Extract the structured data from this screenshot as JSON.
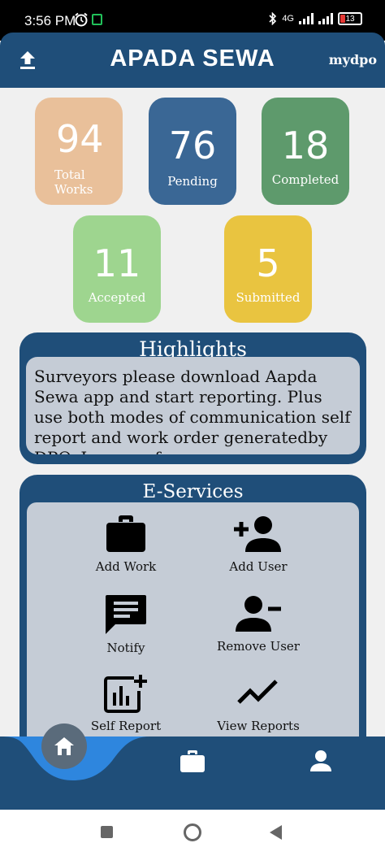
{
  "status_bar": {
    "time": "3:56 PM",
    "network": "4G",
    "battery": "13",
    "icons": [
      "alarm-icon",
      "app-notification-icon",
      "bluetooth-icon",
      "signal-icon",
      "battery-icon"
    ]
  },
  "header": {
    "title": "APADA SEWA",
    "user": "mydpo",
    "left_icon": "upload-icon"
  },
  "stats": {
    "total": {
      "value": "94",
      "label_line1": "Total",
      "label_line2": "Works",
      "color": "#e9c09a"
    },
    "pending": {
      "value": "76",
      "label": "Pending",
      "color": "#3a6795"
    },
    "completed": {
      "value": "18",
      "label": "Completed",
      "color": "#5e9a6c"
    },
    "accepted": {
      "value": "11",
      "label": "Accepted",
      "color": "#9ed58f"
    },
    "submitted": {
      "value": "5",
      "label": "Submitted",
      "color": "#e9c440"
    }
  },
  "highlights": {
    "title": "Highlights",
    "text": "Surveyors please download Aapda Sewa app and start reporting. Plus use both modes of communication self report and work order generatedby DPO. In case of"
  },
  "services": {
    "title": "E-Services",
    "items": [
      {
        "label": "Add Work",
        "icon": "briefcase-icon"
      },
      {
        "label": "Add User",
        "icon": "add-user-icon"
      },
      {
        "label": "Notify",
        "icon": "message-icon"
      },
      {
        "label": "Remove User",
        "icon": "remove-user-icon"
      },
      {
        "label": "Self Report",
        "icon": "report-add-icon"
      },
      {
        "label": "View Reports",
        "icon": "trend-line-icon"
      }
    ]
  },
  "bottom_nav": {
    "items": [
      "home-icon",
      "briefcase-icon",
      "person-icon"
    ],
    "active": "home-icon"
  },
  "colors": {
    "primary": "#1f4e79",
    "panel": "#c5ccd6",
    "accent_curve": "#2e86de"
  }
}
